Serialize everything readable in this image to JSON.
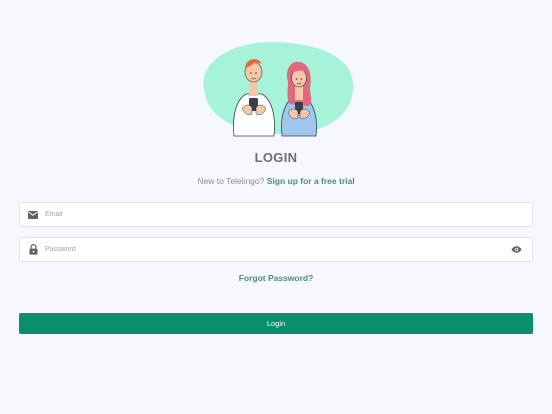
{
  "page": {
    "title": "LOGIN"
  },
  "signup": {
    "prompt": "New to Telelingo?",
    "link_label": "Sign up for a free trial"
  },
  "form": {
    "email_placeholder": "Email",
    "email_value": "",
    "password_placeholder": "Password",
    "password_value": "",
    "forgot_label": "Forgot Password?",
    "submit_label": "Login"
  },
  "icons": {
    "email": "mail-icon",
    "password": "lock-icon",
    "show_password": "eye-icon"
  },
  "colors": {
    "accent": "#0b8f6a",
    "link": "#4d8e72",
    "blob": "#a6f3d9",
    "background": "#f6f8fe"
  }
}
